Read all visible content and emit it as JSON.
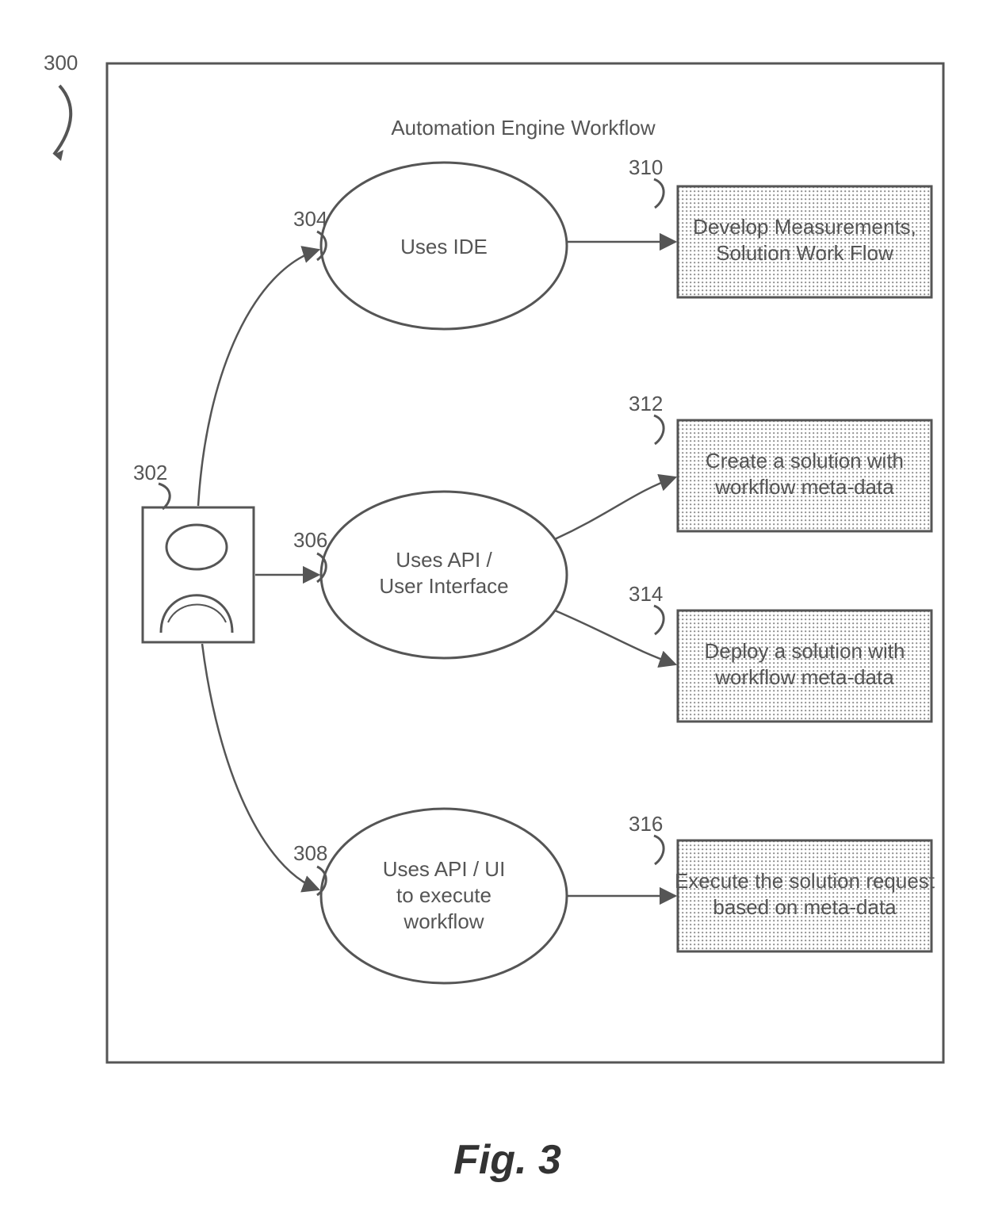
{
  "figure_ref_label": "300",
  "figure_caption": "Fig. 3",
  "title": "Automation Engine Workflow",
  "actor": {
    "ref": "302"
  },
  "usecases": [
    {
      "id": "uc1",
      "ref": "304",
      "label": "Uses IDE"
    },
    {
      "id": "uc2",
      "ref": "306",
      "label_line1": "Uses API /",
      "label_line2": "User Interface"
    },
    {
      "id": "uc3",
      "ref": "308",
      "label_line1": "Uses API / UI",
      "label_line2": "to execute",
      "label_line3": "workflow"
    }
  ],
  "outcomes": [
    {
      "id": "o1",
      "ref": "310",
      "label_line1": "Develop Measurements,",
      "label_line2": "Solution Work Flow"
    },
    {
      "id": "o2",
      "ref": "312",
      "label_line1": "Create a solution with",
      "label_line2": "workflow meta-data"
    },
    {
      "id": "o3",
      "ref": "314",
      "label_line1": "Deploy a solution with",
      "label_line2": "workflow meta-data"
    },
    {
      "id": "o4",
      "ref": "316",
      "label_line1": "Execute the solution request",
      "label_line2": "based on meta-data"
    }
  ]
}
